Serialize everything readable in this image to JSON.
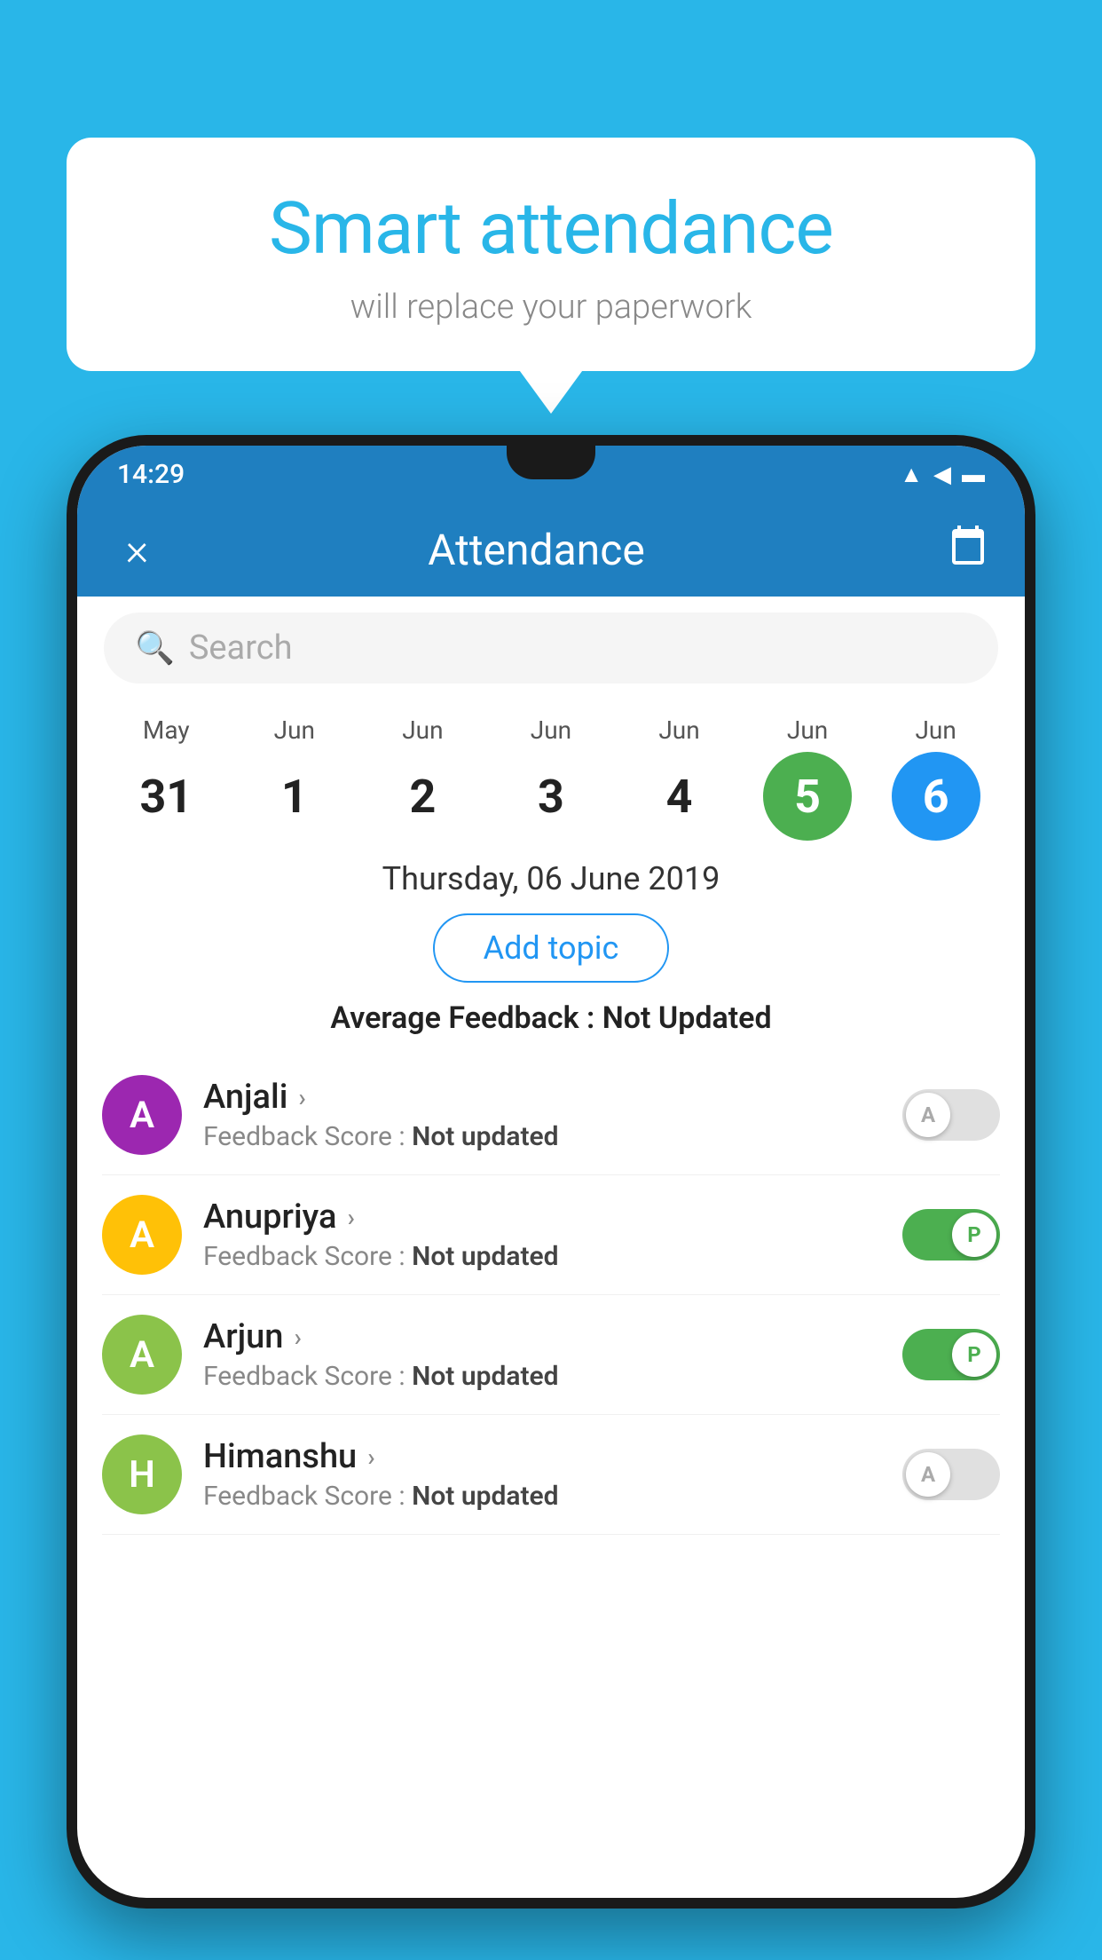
{
  "background_color": "#29B6E8",
  "speech_bubble": {
    "title": "Smart attendance",
    "subtitle": "will replace your paperwork"
  },
  "status_bar": {
    "time": "14:29",
    "wifi": "wifi-icon",
    "signal": "signal-icon",
    "battery": "battery-icon"
  },
  "app_bar": {
    "title": "Attendance",
    "close_label": "×",
    "calendar_label": "📅"
  },
  "search": {
    "placeholder": "Search"
  },
  "date_strip": {
    "columns": [
      {
        "month": "May",
        "day": "31",
        "style": "plain"
      },
      {
        "month": "Jun",
        "day": "1",
        "style": "plain"
      },
      {
        "month": "Jun",
        "day": "2",
        "style": "plain"
      },
      {
        "month": "Jun",
        "day": "3",
        "style": "plain"
      },
      {
        "month": "Jun",
        "day": "4",
        "style": "plain"
      },
      {
        "month": "Jun",
        "day": "5",
        "style": "green"
      },
      {
        "month": "Jun",
        "day": "6",
        "style": "blue"
      }
    ]
  },
  "selected_date": "Thursday, 06 June 2019",
  "add_topic_label": "Add topic",
  "average_feedback": {
    "label": "Average Feedback : ",
    "value": "Not Updated"
  },
  "students": [
    {
      "name": "Anjali",
      "avatar_letter": "A",
      "avatar_color": "#9C27B0",
      "feedback_label": "Feedback Score : ",
      "feedback_value": "Not updated",
      "toggle": "off",
      "toggle_letter": "A"
    },
    {
      "name": "Anupriya",
      "avatar_letter": "A",
      "avatar_color": "#FFC107",
      "feedback_label": "Feedback Score : ",
      "feedback_value": "Not updated",
      "toggle": "on",
      "toggle_letter": "P"
    },
    {
      "name": "Arjun",
      "avatar_letter": "A",
      "avatar_color": "#8BC34A",
      "feedback_label": "Feedback Score : ",
      "feedback_value": "Not updated",
      "toggle": "on",
      "toggle_letter": "P"
    },
    {
      "name": "Himanshu",
      "avatar_letter": "H",
      "avatar_color": "#8BC34A",
      "feedback_label": "Feedback Score : ",
      "feedback_value": "Not updated",
      "toggle": "off",
      "toggle_letter": "A"
    }
  ]
}
